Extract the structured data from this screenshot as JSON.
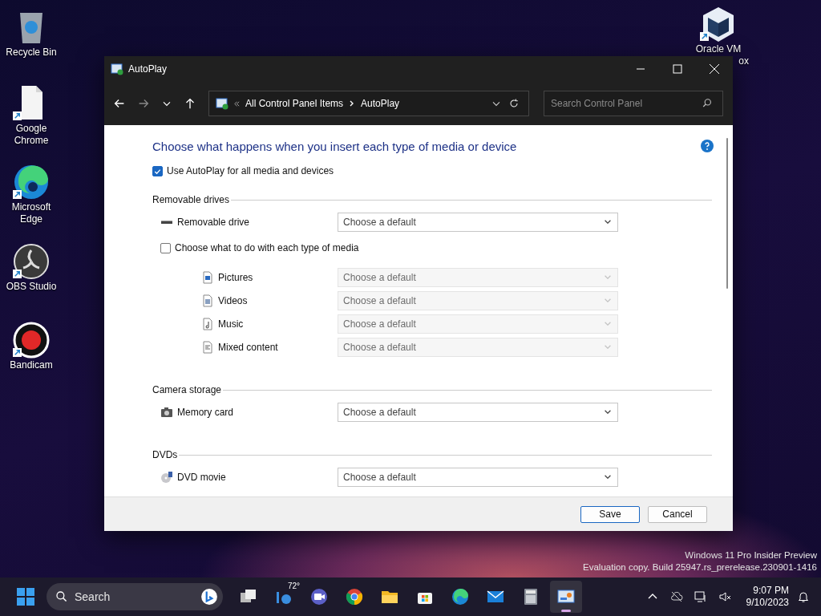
{
  "desktop_icons": [
    {
      "kind": "recycle",
      "lines": [
        "Recycle Bin"
      ]
    },
    {
      "kind": "blank",
      "lines": [
        "Google",
        "Chrome"
      ]
    },
    {
      "kind": "edge",
      "lines": [
        "Microsoft",
        "Edge"
      ]
    },
    {
      "kind": "obs",
      "lines": [
        "OBS Studio"
      ]
    },
    {
      "kind": "record",
      "lines": [
        "Bandicam"
      ]
    }
  ],
  "desktop_icons_right": [
    {
      "kind": "cube",
      "lines": [
        "Oracle VM",
        "ox"
      ]
    }
  ],
  "window": {
    "title": "AutoPlay",
    "breadcrumb": [
      "All Control Panel Items",
      "AutoPlay"
    ],
    "search": {
      "placeholder": "Search Control Panel"
    },
    "heading": "Choose what happens when you insert each type of media or device",
    "use_autoplay": {
      "label": "Use AutoPlay for all media and devices",
      "checked": true
    },
    "sections": [
      {
        "title": "Removable drives",
        "items": [
          {
            "kind": "drive",
            "label": "Removable drive",
            "value": "Choose a default",
            "disabled": false
          },
          {
            "kind": "checkbox",
            "label": "Choose what to do with each type of media",
            "checked": false
          },
          {
            "kind": "pictures",
            "label": "Pictures",
            "value": "Choose a default",
            "disabled": true
          },
          {
            "kind": "videos",
            "label": "Videos",
            "value": "Choose a default",
            "disabled": true
          },
          {
            "kind": "music",
            "label": "Music",
            "value": "Choose a default",
            "disabled": true
          },
          {
            "kind": "mixed",
            "label": "Mixed content",
            "value": "Choose a default",
            "disabled": true
          }
        ]
      },
      {
        "title": "Camera storage",
        "items": [
          {
            "kind": "camera",
            "label": "Memory card",
            "value": "Choose a default",
            "disabled": false
          }
        ]
      },
      {
        "title": "DVDs",
        "items": [
          {
            "kind": "dvd",
            "label": "DVD movie",
            "value": "Choose a default",
            "disabled": false
          }
        ]
      }
    ],
    "buttons": [
      {
        "label": "Save",
        "primary": true
      },
      {
        "label": "Cancel",
        "primary": false
      }
    ]
  },
  "watermark": [
    "Windows 11 Pro Insider Preview",
    "Evaluation copy. Build 25947.rs_prerelease.230901-1416"
  ],
  "taskbar": {
    "search": {
      "placeholder": "Search"
    },
    "apps": [
      {
        "kind": "taskview",
        "active": false
      },
      {
        "kind": "weather",
        "text": "72°",
        "active": false
      },
      {
        "kind": "meet",
        "active": false
      },
      {
        "kind": "chrome",
        "active": false
      },
      {
        "kind": "folder",
        "active": false
      },
      {
        "kind": "store",
        "active": false
      },
      {
        "kind": "edge",
        "active": false
      },
      {
        "kind": "mail",
        "active": false
      },
      {
        "kind": "calculator",
        "active": false
      },
      {
        "kind": "controlpanel",
        "active": true
      }
    ],
    "clock": {
      "time": "9:07 PM",
      "date": "9/10/2023"
    }
  }
}
